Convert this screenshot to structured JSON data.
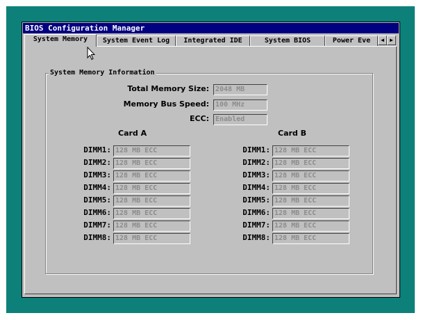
{
  "window": {
    "title": "BIOS Configuration Manager"
  },
  "tabs": [
    {
      "label": "System Memory",
      "active": true
    },
    {
      "label": "System Event Log",
      "active": false
    },
    {
      "label": "Integrated IDE",
      "active": false
    },
    {
      "label": "System BIOS",
      "active": false
    },
    {
      "label": "Power Eve",
      "active": false
    }
  ],
  "tab_scroll": {
    "left_icon": "left-arrow-icon",
    "right_icon": "right-arrow-icon"
  },
  "memory_info": {
    "group_title": "System Memory Information",
    "total_label": "Total Memory Size:",
    "total_value": "2048 MB",
    "speed_label": "Memory Bus Speed:",
    "speed_value": "100 MHz",
    "ecc_label": "ECC:",
    "ecc_value": "Enabled"
  },
  "card_a": {
    "title": "Card A",
    "slots": [
      {
        "label": "DIMM1:",
        "value": "128 MB ECC"
      },
      {
        "label": "DIMM2:",
        "value": "128 MB ECC"
      },
      {
        "label": "DIMM3:",
        "value": "128 MB ECC"
      },
      {
        "label": "DIMM4:",
        "value": "128 MB ECC"
      },
      {
        "label": "DIMM5:",
        "value": "128 MB ECC"
      },
      {
        "label": "DIMM6:",
        "value": "128 MB ECC"
      },
      {
        "label": "DIMM7:",
        "value": "128 MB ECC"
      },
      {
        "label": "DIMM8:",
        "value": "128 MB ECC"
      }
    ]
  },
  "card_b": {
    "title": "Card B",
    "slots": [
      {
        "label": "DIMM1:",
        "value": "128 MB ECC"
      },
      {
        "label": "DIMM2:",
        "value": "128 MB ECC"
      },
      {
        "label": "DIMM3:",
        "value": "128 MB ECC"
      },
      {
        "label": "DIMM4:",
        "value": "128 MB ECC"
      },
      {
        "label": "DIMM5:",
        "value": "128 MB ECC"
      },
      {
        "label": "DIMM6:",
        "value": "128 MB ECC"
      },
      {
        "label": "DIMM7:",
        "value": "128 MB ECC"
      },
      {
        "label": "DIMM8:",
        "value": "128 MB ECC"
      }
    ]
  },
  "colors": {
    "desktop": "#0d807a",
    "titlebar": "#000080",
    "face": "#c0c0c0",
    "disabled_text": "#8c8c8c"
  }
}
